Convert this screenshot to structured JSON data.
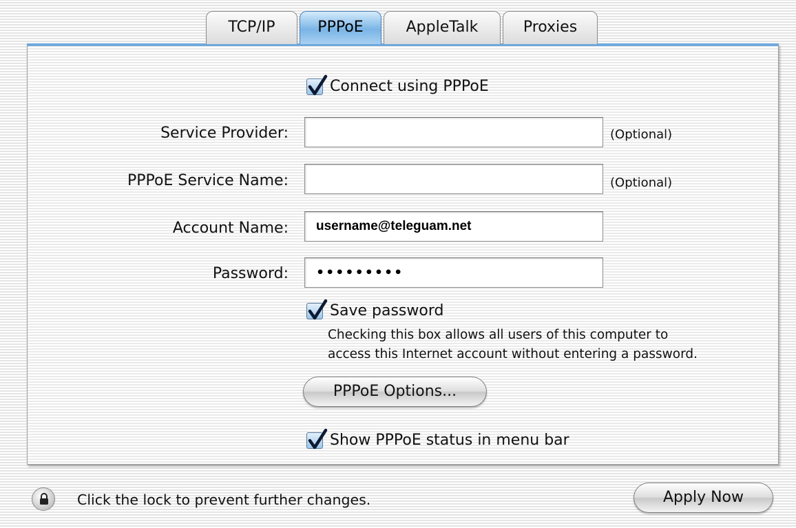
{
  "tabs": [
    {
      "label": "TCP/IP",
      "active": false
    },
    {
      "label": "PPPoE",
      "active": true
    },
    {
      "label": "AppleTalk",
      "active": false
    },
    {
      "label": "Proxies",
      "active": false
    }
  ],
  "pppoe": {
    "connect_checkbox": {
      "label": "Connect using PPPoE",
      "checked": true
    },
    "fields": {
      "service_provider": {
        "label": "Service Provider:",
        "value": "",
        "hint": "(Optional)"
      },
      "service_name": {
        "label": "PPPoE Service Name:",
        "value": "",
        "hint": "(Optional)"
      },
      "account_name": {
        "label": "Account Name:",
        "value": "username@teleguam.net"
      },
      "password": {
        "label": "Password:",
        "value": "•••••••••"
      }
    },
    "save_password": {
      "label": "Save password",
      "checked": true,
      "note_line1": "Checking this box allows all users of this computer to",
      "note_line2": "access this Internet account without entering a password."
    },
    "options_button": "PPPoE Options...",
    "show_status": {
      "label": "Show PPPoE status in menu bar",
      "checked": true
    }
  },
  "footer": {
    "lock_icon": "lock-icon",
    "lock_text": "Click the lock to prevent further changes.",
    "apply_button": "Apply Now"
  },
  "colors": {
    "active_tab": "#7ab4e6",
    "panel_accent": "#6fa8dc",
    "checkbox_fill": "#9cc7ea",
    "checkmark": "#0d1a33"
  }
}
